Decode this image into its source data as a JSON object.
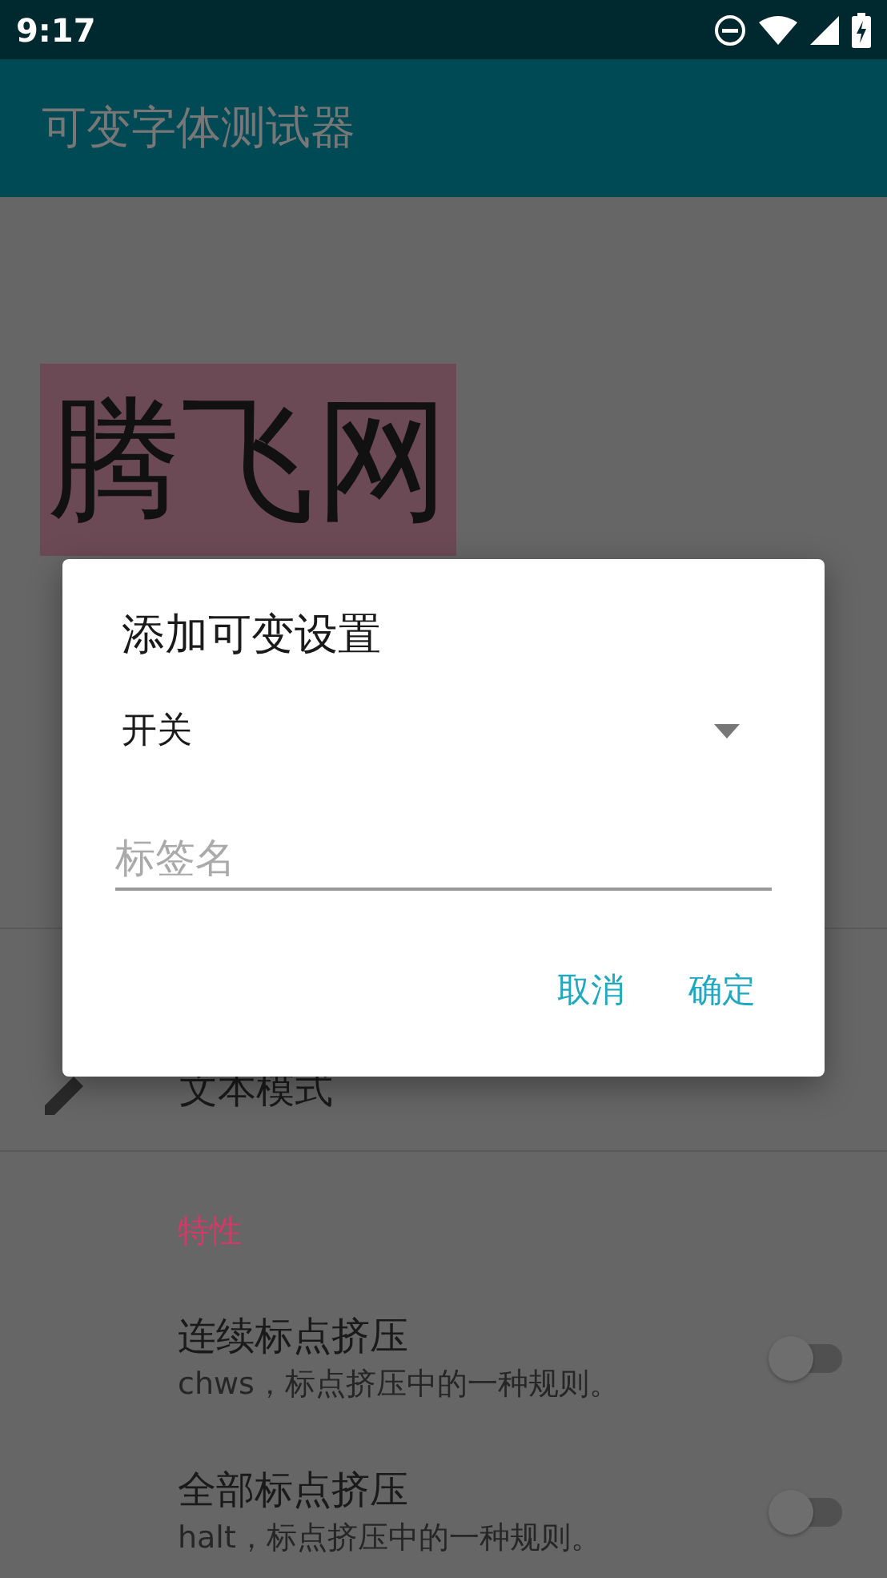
{
  "status_bar": {
    "time": "9:17"
  },
  "app_bar": {
    "title": "可变字体测试器"
  },
  "preview": {
    "text": "腾飞网"
  },
  "mode_row": {
    "label": "文本模式"
  },
  "section": {
    "header": "特性"
  },
  "settings": [
    {
      "title": "连续标点挤压",
      "subtitle": "chws，标点挤压中的一种规则。",
      "on": false
    },
    {
      "title": "全部标点挤压",
      "subtitle": "halt，标点挤压中的一种规则。",
      "on": false
    }
  ],
  "dialog": {
    "title": "添加可变设置",
    "dropdown": {
      "value": "开关"
    },
    "field": {
      "placeholder": "标签名"
    },
    "buttons": [
      "取消",
      "确定"
    ]
  }
}
